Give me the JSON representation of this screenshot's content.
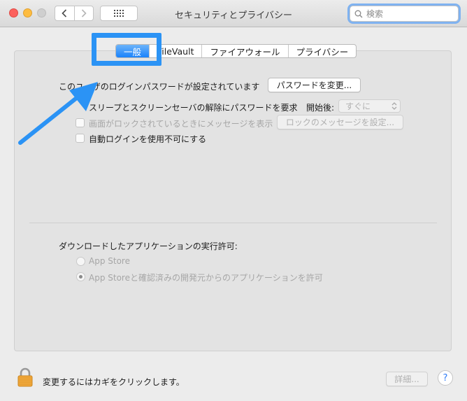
{
  "window": {
    "title": "セキュリティとプライバシー",
    "search_placeholder": "検索"
  },
  "tabs": [
    {
      "label": "一般",
      "active": true
    },
    {
      "label": "FileVault",
      "active": false
    },
    {
      "label": "ファイアウォール",
      "active": false
    },
    {
      "label": "プライバシー",
      "active": false
    }
  ],
  "general": {
    "password_set_text": "このユーザのログインパスワードが設定されています",
    "change_password_button": "パスワードを変更...",
    "require_password_label": "スリープとスクリーンセーバの解除にパスワードを要求",
    "start_after_label": "開始後:",
    "start_after_value": "すぐに",
    "show_message_label": "画面がロックされているときにメッセージを表示",
    "set_lock_message_button": "ロックのメッセージを設定...",
    "disable_auto_login_label": "自動ログインを使用不可にする"
  },
  "downloads": {
    "heading": "ダウンロードしたアプリケーションの実行許可:",
    "options": [
      {
        "label": "App Store",
        "selected": false
      },
      {
        "label": "App Storeと確認済みの開発元からのアプリケーションを許可",
        "selected": true
      }
    ]
  },
  "footer": {
    "lock_text": "変更するにはカギをクリックします。",
    "advanced_button": "詳細...",
    "help_label": "?"
  },
  "colors": {
    "accent": "#1a82fb",
    "annotation": "#2b93f5"
  }
}
